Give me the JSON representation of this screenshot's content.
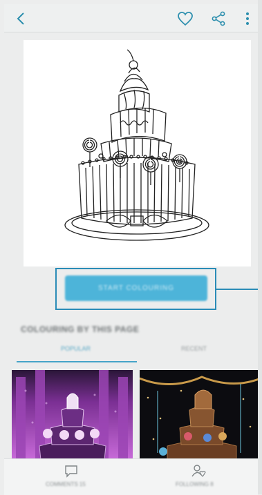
{
  "app_bar": {
    "back_icon": "chevron-left-icon",
    "favorite_icon": "heart-icon",
    "share_icon": "share-icon",
    "more_icon": "more-vertical-icon"
  },
  "preview": {
    "subject": "cake-coloring-outline"
  },
  "primary_action": {
    "label": "START COLOURING"
  },
  "section": {
    "title": "COLOURING BY THIS PAGE",
    "tabs": [
      {
        "label": "POPULAR",
        "selected": true
      },
      {
        "label": "RECENT",
        "selected": false
      }
    ]
  },
  "bottom_nav": {
    "items": [
      {
        "label": "COMMENTS 15",
        "icon": "comment-icon"
      },
      {
        "label": "FOLLOWING 8",
        "icon": "user-follow-icon"
      }
    ]
  },
  "colors": {
    "accent": "#2a8cb7",
    "button": "#4db4d9"
  }
}
